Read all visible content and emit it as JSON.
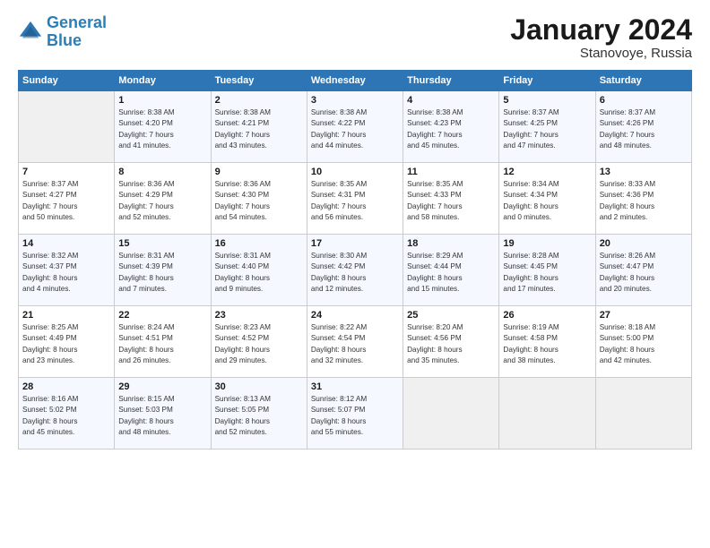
{
  "header": {
    "logo_line1": "General",
    "logo_line2": "Blue",
    "month_title": "January 2024",
    "subtitle": "Stanovoye, Russia"
  },
  "days_of_week": [
    "Sunday",
    "Monday",
    "Tuesday",
    "Wednesday",
    "Thursday",
    "Friday",
    "Saturday"
  ],
  "weeks": [
    [
      {
        "day": "",
        "info": ""
      },
      {
        "day": "1",
        "info": "Sunrise: 8:38 AM\nSunset: 4:20 PM\nDaylight: 7 hours\nand 41 minutes."
      },
      {
        "day": "2",
        "info": "Sunrise: 8:38 AM\nSunset: 4:21 PM\nDaylight: 7 hours\nand 43 minutes."
      },
      {
        "day": "3",
        "info": "Sunrise: 8:38 AM\nSunset: 4:22 PM\nDaylight: 7 hours\nand 44 minutes."
      },
      {
        "day": "4",
        "info": "Sunrise: 8:38 AM\nSunset: 4:23 PM\nDaylight: 7 hours\nand 45 minutes."
      },
      {
        "day": "5",
        "info": "Sunrise: 8:37 AM\nSunset: 4:25 PM\nDaylight: 7 hours\nand 47 minutes."
      },
      {
        "day": "6",
        "info": "Sunrise: 8:37 AM\nSunset: 4:26 PM\nDaylight: 7 hours\nand 48 minutes."
      }
    ],
    [
      {
        "day": "7",
        "info": "Sunrise: 8:37 AM\nSunset: 4:27 PM\nDaylight: 7 hours\nand 50 minutes."
      },
      {
        "day": "8",
        "info": "Sunrise: 8:36 AM\nSunset: 4:29 PM\nDaylight: 7 hours\nand 52 minutes."
      },
      {
        "day": "9",
        "info": "Sunrise: 8:36 AM\nSunset: 4:30 PM\nDaylight: 7 hours\nand 54 minutes."
      },
      {
        "day": "10",
        "info": "Sunrise: 8:35 AM\nSunset: 4:31 PM\nDaylight: 7 hours\nand 56 minutes."
      },
      {
        "day": "11",
        "info": "Sunrise: 8:35 AM\nSunset: 4:33 PM\nDaylight: 7 hours\nand 58 minutes."
      },
      {
        "day": "12",
        "info": "Sunrise: 8:34 AM\nSunset: 4:34 PM\nDaylight: 8 hours\nand 0 minutes."
      },
      {
        "day": "13",
        "info": "Sunrise: 8:33 AM\nSunset: 4:36 PM\nDaylight: 8 hours\nand 2 minutes."
      }
    ],
    [
      {
        "day": "14",
        "info": "Sunrise: 8:32 AM\nSunset: 4:37 PM\nDaylight: 8 hours\nand 4 minutes."
      },
      {
        "day": "15",
        "info": "Sunrise: 8:31 AM\nSunset: 4:39 PM\nDaylight: 8 hours\nand 7 minutes."
      },
      {
        "day": "16",
        "info": "Sunrise: 8:31 AM\nSunset: 4:40 PM\nDaylight: 8 hours\nand 9 minutes."
      },
      {
        "day": "17",
        "info": "Sunrise: 8:30 AM\nSunset: 4:42 PM\nDaylight: 8 hours\nand 12 minutes."
      },
      {
        "day": "18",
        "info": "Sunrise: 8:29 AM\nSunset: 4:44 PM\nDaylight: 8 hours\nand 15 minutes."
      },
      {
        "day": "19",
        "info": "Sunrise: 8:28 AM\nSunset: 4:45 PM\nDaylight: 8 hours\nand 17 minutes."
      },
      {
        "day": "20",
        "info": "Sunrise: 8:26 AM\nSunset: 4:47 PM\nDaylight: 8 hours\nand 20 minutes."
      }
    ],
    [
      {
        "day": "21",
        "info": "Sunrise: 8:25 AM\nSunset: 4:49 PM\nDaylight: 8 hours\nand 23 minutes."
      },
      {
        "day": "22",
        "info": "Sunrise: 8:24 AM\nSunset: 4:51 PM\nDaylight: 8 hours\nand 26 minutes."
      },
      {
        "day": "23",
        "info": "Sunrise: 8:23 AM\nSunset: 4:52 PM\nDaylight: 8 hours\nand 29 minutes."
      },
      {
        "day": "24",
        "info": "Sunrise: 8:22 AM\nSunset: 4:54 PM\nDaylight: 8 hours\nand 32 minutes."
      },
      {
        "day": "25",
        "info": "Sunrise: 8:20 AM\nSunset: 4:56 PM\nDaylight: 8 hours\nand 35 minutes."
      },
      {
        "day": "26",
        "info": "Sunrise: 8:19 AM\nSunset: 4:58 PM\nDaylight: 8 hours\nand 38 minutes."
      },
      {
        "day": "27",
        "info": "Sunrise: 8:18 AM\nSunset: 5:00 PM\nDaylight: 8 hours\nand 42 minutes."
      }
    ],
    [
      {
        "day": "28",
        "info": "Sunrise: 8:16 AM\nSunset: 5:02 PM\nDaylight: 8 hours\nand 45 minutes."
      },
      {
        "day": "29",
        "info": "Sunrise: 8:15 AM\nSunset: 5:03 PM\nDaylight: 8 hours\nand 48 minutes."
      },
      {
        "day": "30",
        "info": "Sunrise: 8:13 AM\nSunset: 5:05 PM\nDaylight: 8 hours\nand 52 minutes."
      },
      {
        "day": "31",
        "info": "Sunrise: 8:12 AM\nSunset: 5:07 PM\nDaylight: 8 hours\nand 55 minutes."
      },
      {
        "day": "",
        "info": ""
      },
      {
        "day": "",
        "info": ""
      },
      {
        "day": "",
        "info": ""
      }
    ]
  ]
}
